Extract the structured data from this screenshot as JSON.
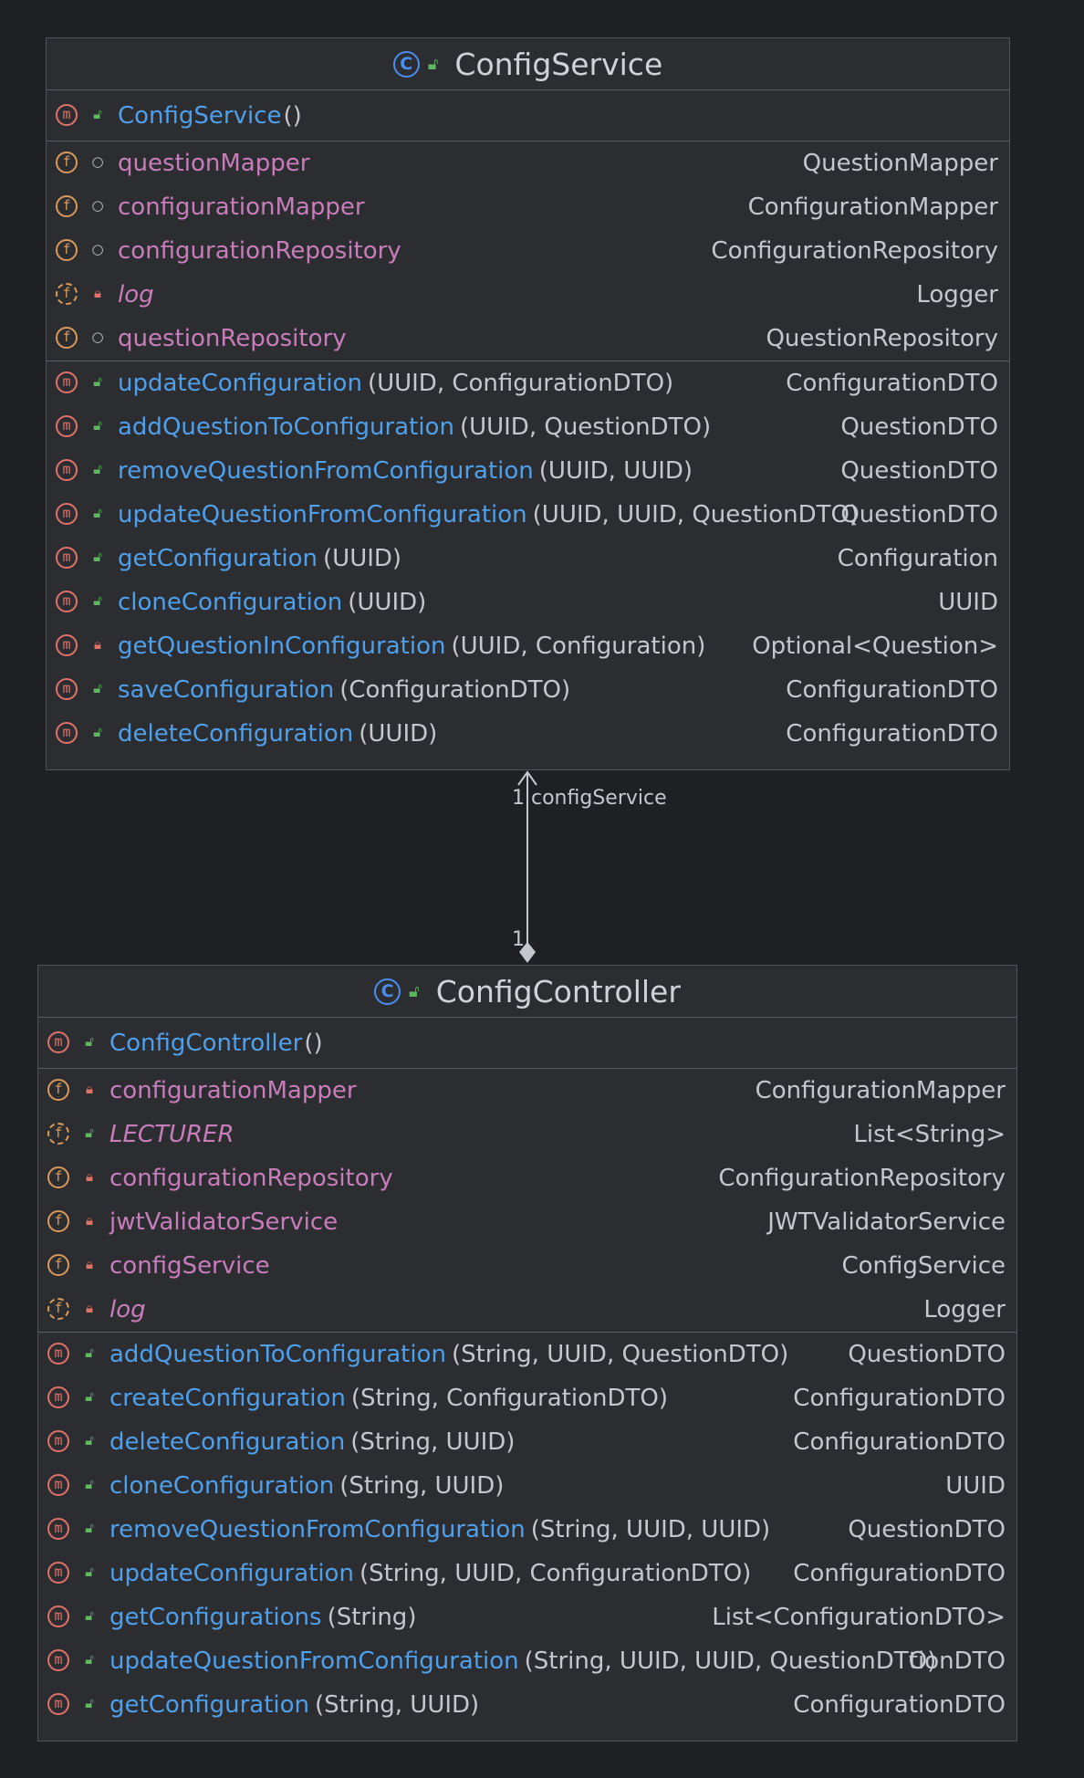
{
  "config_service": {
    "header": "ConfigService",
    "constructor": {
      "name": "ConfigService",
      "params": "()",
      "visibility": "public"
    },
    "fields": [
      {
        "name": "questionMapper",
        "type": "QuestionMapper",
        "visibility": "package",
        "static": false
      },
      {
        "name": "configurationMapper",
        "type": "ConfigurationMapper",
        "visibility": "package",
        "static": false
      },
      {
        "name": "configurationRepository",
        "type": "ConfigurationRepository",
        "visibility": "package",
        "static": false
      },
      {
        "name": "log",
        "type": "Logger",
        "visibility": "private",
        "static": true
      },
      {
        "name": "questionRepository",
        "type": "QuestionRepository",
        "visibility": "package",
        "static": false
      }
    ],
    "methods": [
      {
        "name": "updateConfiguration",
        "params": "(UUID, ConfigurationDTO)",
        "type": "ConfigurationDTO",
        "visibility": "public"
      },
      {
        "name": "addQuestionToConfiguration",
        "params": "(UUID, QuestionDTO)",
        "type": "QuestionDTO",
        "visibility": "public"
      },
      {
        "name": "removeQuestionFromConfiguration",
        "params": "(UUID, UUID)",
        "type": "QuestionDTO",
        "visibility": "public"
      },
      {
        "name": "updateQuestionFromConfiguration",
        "params": "(UUID, UUID, QuestionDTO)",
        "type": "QuestionDTO",
        "visibility": "public"
      },
      {
        "name": "getConfiguration",
        "params": "(UUID)",
        "type": "Configuration",
        "visibility": "public"
      },
      {
        "name": "cloneConfiguration",
        "params": "(UUID)",
        "type": "UUID",
        "visibility": "public"
      },
      {
        "name": "getQuestionInConfiguration",
        "params": "(UUID, Configuration)",
        "type": "Optional<Question>",
        "visibility": "private"
      },
      {
        "name": "saveConfiguration",
        "params": "(ConfigurationDTO)",
        "type": "ConfigurationDTO",
        "visibility": "public"
      },
      {
        "name": "deleteConfiguration",
        "params": "(UUID)",
        "type": "ConfigurationDTO",
        "visibility": "public"
      }
    ]
  },
  "relation": {
    "label": "configService",
    "target_multiplicity": "1",
    "source_multiplicity": "1"
  },
  "config_controller": {
    "header": "ConfigController",
    "constructor": {
      "name": "ConfigController",
      "params": "()",
      "visibility": "public"
    },
    "fields": [
      {
        "name": "configurationMapper",
        "type": "ConfigurationMapper",
        "visibility": "private",
        "static": false
      },
      {
        "name": "LECTURER",
        "type": "List<String>",
        "visibility": "public",
        "static": true
      },
      {
        "name": "configurationRepository",
        "type": "ConfigurationRepository",
        "visibility": "private",
        "static": false
      },
      {
        "name": "jwtValidatorService",
        "type": "JWTValidatorService",
        "visibility": "private",
        "static": false
      },
      {
        "name": "configService",
        "type": "ConfigService",
        "visibility": "private",
        "static": false
      },
      {
        "name": "log",
        "type": "Logger",
        "visibility": "private",
        "static": true
      }
    ],
    "methods": [
      {
        "name": "addQuestionToConfiguration",
        "params": "(String, UUID, QuestionDTO)",
        "type": "QuestionDTO",
        "visibility": "public"
      },
      {
        "name": "createConfiguration",
        "params": "(String, ConfigurationDTO)",
        "type": "ConfigurationDTO",
        "visibility": "public"
      },
      {
        "name": "deleteConfiguration",
        "params": "(String, UUID)",
        "type": "ConfigurationDTO",
        "visibility": "public"
      },
      {
        "name": "cloneConfiguration",
        "params": "(String, UUID)",
        "type": "UUID",
        "visibility": "public"
      },
      {
        "name": "removeQuestionFromConfiguration",
        "params": "(String, UUID, UUID)",
        "type": "QuestionDTO",
        "visibility": "public"
      },
      {
        "name": "updateConfiguration",
        "params": "(String, UUID, ConfigurationDTO)",
        "type": "ConfigurationDTO",
        "visibility": "public"
      },
      {
        "name": "getConfigurations",
        "params": "(String)",
        "type": "List<ConfigurationDTO>",
        "visibility": "public"
      },
      {
        "name": "updateQuestionFromConfiguration",
        "params": "(String, UUID, UUID, QuestionDTO)",
        "type": "tionDTO",
        "visibility": "public"
      },
      {
        "name": "getConfiguration",
        "params": "(String, UUID)",
        "type": "ConfigurationDTO",
        "visibility": "public"
      }
    ]
  },
  "icons": {
    "class": "class-icon",
    "method": "method-icon",
    "field": "field-icon",
    "static_field": "static-field-icon",
    "public": "public-lock-open-icon",
    "private": "private-lock-icon",
    "package": "package-circle-icon"
  }
}
